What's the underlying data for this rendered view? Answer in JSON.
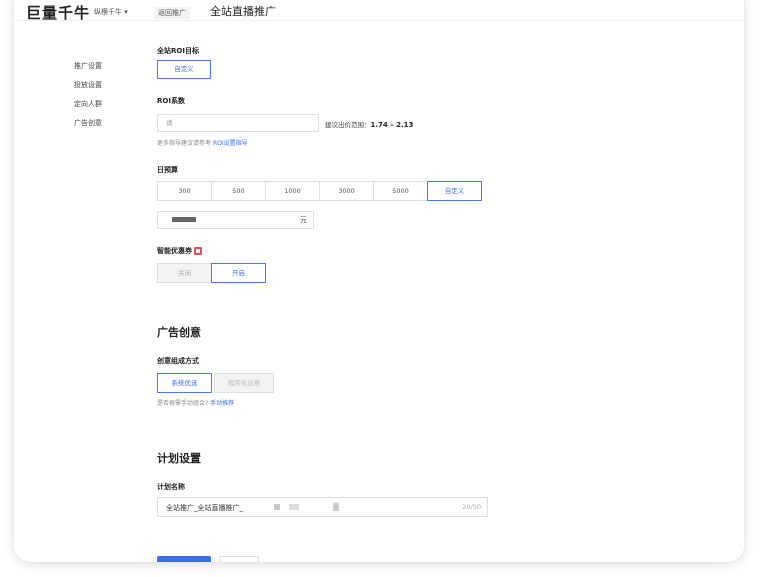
{
  "header": {
    "brand": "巨量千牛",
    "brand_sub": "纵横千牛 ▾",
    "crumb_tag": "返回推广",
    "crumb_title": "全站直播推广"
  },
  "sidebar": {
    "items": [
      {
        "label": "推广设置"
      },
      {
        "label": "投放设置"
      },
      {
        "label": "定向人群"
      },
      {
        "label": "广告创意"
      }
    ]
  },
  "roi_goal": {
    "label": "全站ROI目标",
    "option": "自定义"
  },
  "roi_coef": {
    "label": "ROI系数",
    "placeholder": "请",
    "suggest_prefix": "建议出价范围：",
    "suggest_range": "1.74 – 2.13",
    "hint": "更多指导建议请参考",
    "hint_link": "ROI设置指导"
  },
  "daily_budget": {
    "label": "日预算",
    "options": [
      "300",
      "500",
      "1000",
      "3000",
      "5000",
      "自定义"
    ],
    "active_index": 5,
    "unit": "元"
  },
  "smart_coupon": {
    "label": "智能优惠券",
    "off": "关闭",
    "on": "开启"
  },
  "creative": {
    "section_title": "广告创意",
    "field_label": "创意组成方式",
    "opt_system": "系统优选",
    "opt_program": "程序化创意",
    "hint": "是否按需手动组合?",
    "hint_link": "手动推荐"
  },
  "plan": {
    "section_title": "计划设置",
    "name_label": "计划名称",
    "name_value": "全站推广_全站直播推广_",
    "counter": "20/50"
  },
  "colors": {
    "accent": "#3d6cf0",
    "badge": "#e5504f"
  }
}
